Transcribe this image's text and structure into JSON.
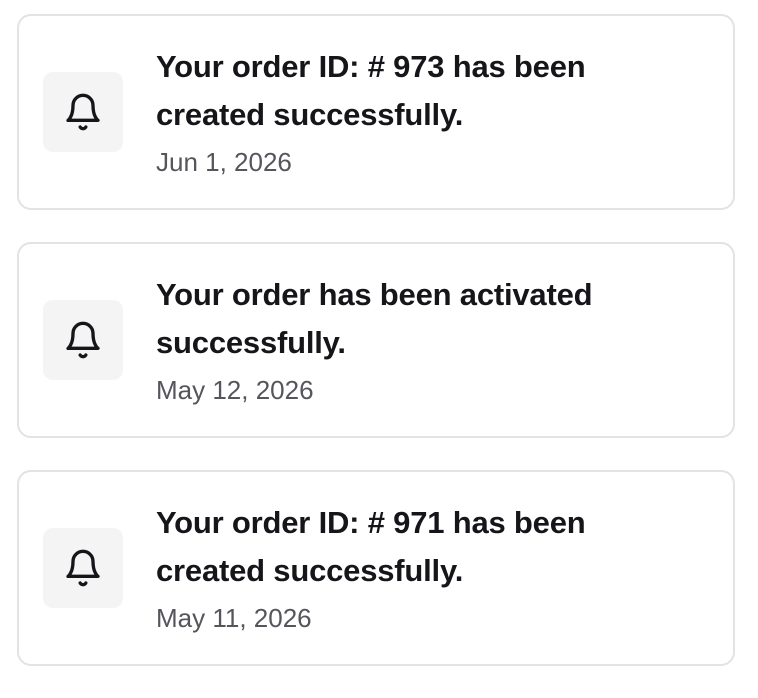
{
  "notifications": [
    {
      "icon": "bell-icon",
      "message": "Your order ID: # 973 has been created successfully.",
      "date": "Jun 1, 2026"
    },
    {
      "icon": "bell-icon",
      "message": "Your order has been activated successfully.",
      "date": "May 12, 2026"
    },
    {
      "icon": "bell-icon",
      "message": "Your order ID: # 971 has been created successfully.",
      "date": "May 11, 2026"
    }
  ]
}
